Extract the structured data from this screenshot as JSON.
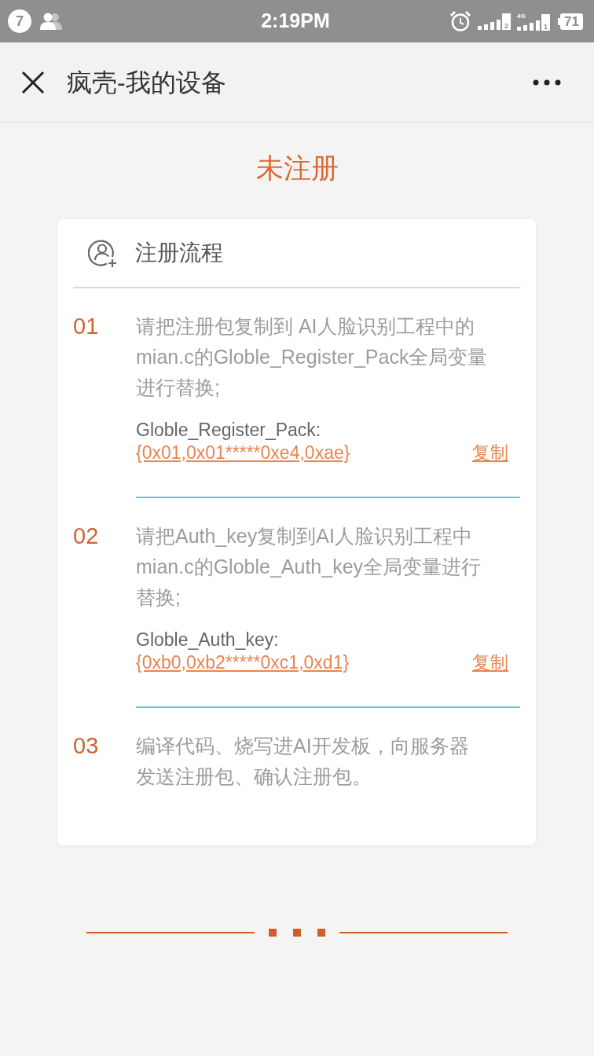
{
  "status_bar": {
    "notification_count": "7",
    "time": "2:19PM",
    "signals": [
      {
        "slot": "2"
      },
      {
        "network": "4G",
        "slot": "1"
      }
    ],
    "battery": "71"
  },
  "nav": {
    "title": "疯壳-我的设备"
  },
  "status": "未注册",
  "card": {
    "title": "注册流程",
    "steps": [
      {
        "number": "01",
        "text": "请把注册包复制到 AI人脸识别工程中的mian.c的Globle_Register_Pack全局变量进行替换;",
        "field": {
          "label": "Globle_Register_Pack:",
          "value": "{0x01,0x01*****0xe4,0xae}",
          "action": "复制"
        }
      },
      {
        "number": "02",
        "text": "请把Auth_key复制到AI人脸识别工程中mian.c的Globle_Auth_key全局变量进行替换;",
        "field": {
          "label": "Globle_Auth_key:",
          "value": "{0xb0,0xb2*****0xc1,0xd1}",
          "action": "复制"
        }
      },
      {
        "number": "03",
        "text": "编译代码、烧写进AI开发板，向服务器发送注册包、确认注册包。"
      }
    ]
  }
}
